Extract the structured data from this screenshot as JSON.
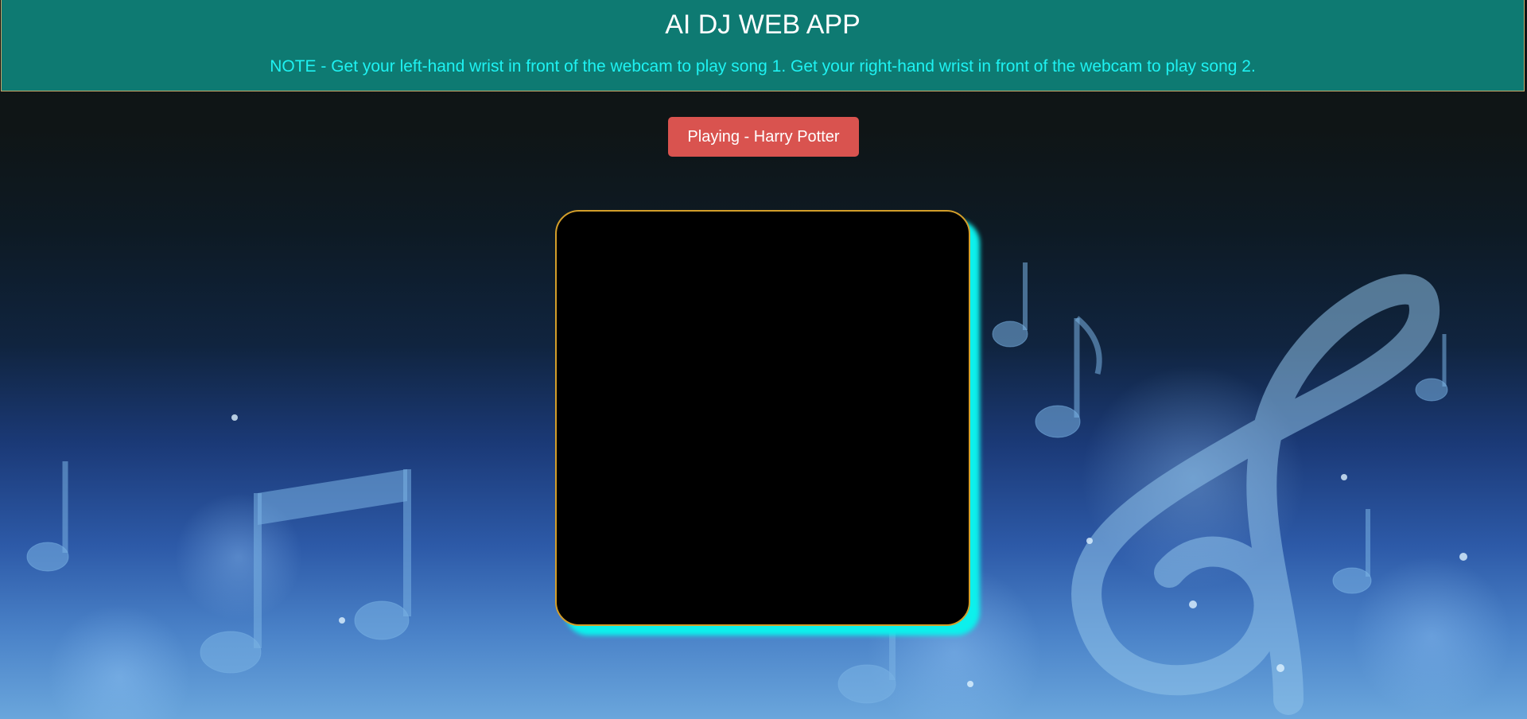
{
  "header": {
    "title": "AI DJ WEB APP",
    "note": "NOTE - Get your left-hand wrist in front of the webcam to play song 1. Get your right-hand wrist in front of the webcam to play song 2."
  },
  "status_button": {
    "label": "Playing - Harry Potter"
  },
  "colors": {
    "header_bg": "#0e7a72",
    "note_text": "#1ef2f2",
    "button_bg": "#d9534f",
    "frame_border": "#d39e2a",
    "frame_glow": "#0df0ec"
  },
  "icons": {
    "background_art": "music-notes-treble-clef"
  }
}
